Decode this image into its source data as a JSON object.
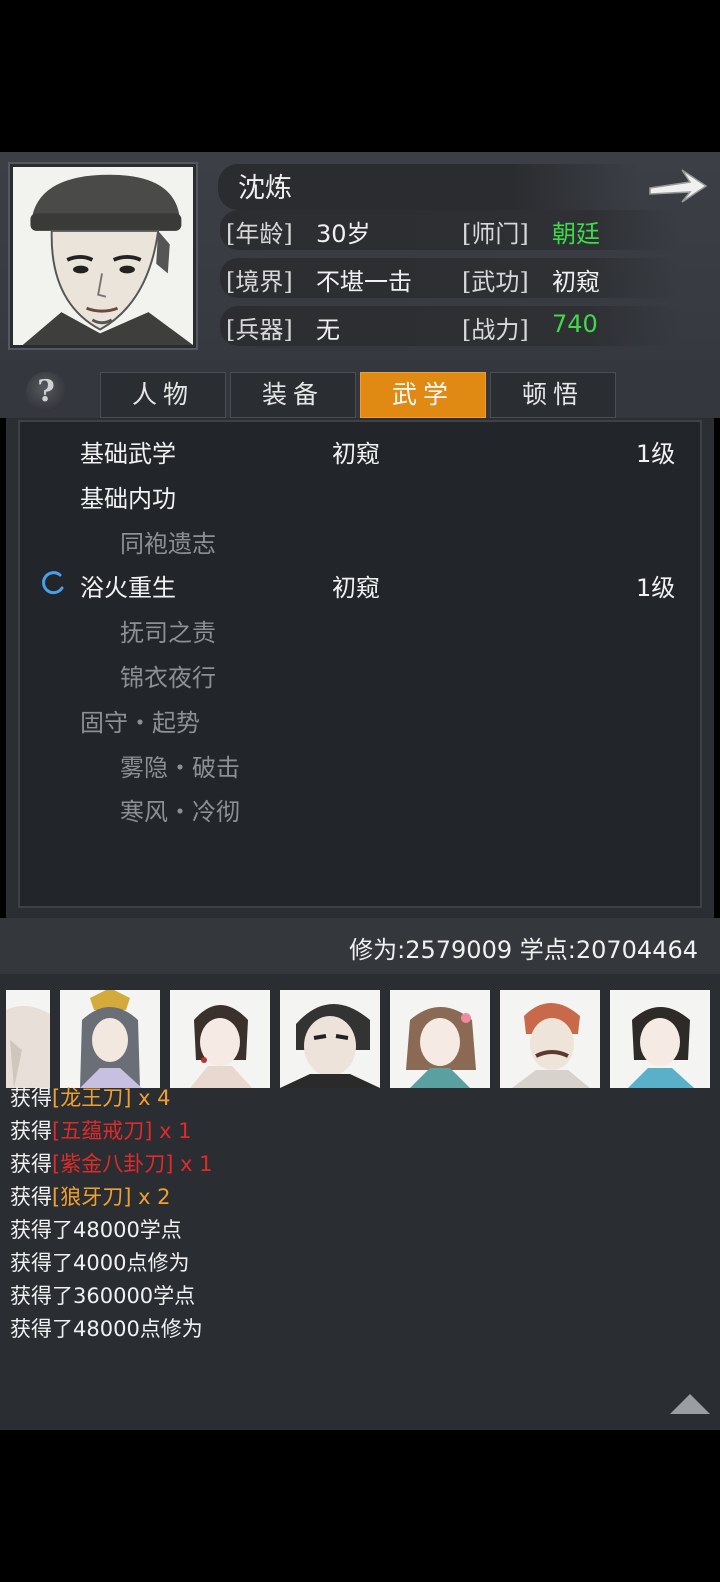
{
  "character": {
    "name": "沈炼",
    "age_label": "[年龄]",
    "age": "30岁",
    "sect_label": "[师门]",
    "sect": "朝廷",
    "realm_label": "[境界]",
    "realm": "不堪一击",
    "kungfu_label": "[武功]",
    "kungfu": "初窥",
    "weapon_label": "[兵器]",
    "weapon": "无",
    "power_label": "[战力]",
    "power": "740"
  },
  "tabs": [
    "人物",
    "装备",
    "武学",
    "顿悟"
  ],
  "active_tab": "武学",
  "help_label": "?",
  "skills": [
    {
      "name": "基础武学",
      "grade": "初窥",
      "level": "1级",
      "style": "main"
    },
    {
      "name": "基础内功",
      "grade": "",
      "level": "",
      "style": "main"
    },
    {
      "name": "同袍遗志",
      "grade": "",
      "level": "",
      "style": "dim"
    },
    {
      "name": "浴火重生",
      "grade": "初窥",
      "level": "1级",
      "style": "main"
    },
    {
      "name": "抚司之责",
      "grade": "",
      "level": "",
      "style": "dim"
    },
    {
      "name": "锦衣夜行",
      "grade": "",
      "level": "",
      "style": "dim"
    },
    {
      "name": "固守・起势",
      "grade": "",
      "level": "",
      "style": "dim"
    },
    {
      "name": "雾隐・破击",
      "grade": "",
      "level": "",
      "style": "dim"
    },
    {
      "name": "寒风・冷彻",
      "grade": "",
      "level": "",
      "style": "dim"
    }
  ],
  "stats": {
    "cultivation_label": "修为:",
    "cultivation": "2579009",
    "points_label": "学点:",
    "points": "20704464"
  },
  "log": [
    {
      "prefix": "获得",
      "item": "[龙王刀]",
      "suffix": " x 4",
      "color": "#f0a030"
    },
    {
      "prefix": "获得",
      "item": "[五蕴戒刀]",
      "suffix": " x 1",
      "color": "#e02a2a"
    },
    {
      "prefix": "获得",
      "item": "[紫金八卦刀]",
      "suffix": " x 1",
      "color": "#e02a2a"
    },
    {
      "prefix": "获得",
      "item": "[狼牙刀]",
      "suffix": " x 2",
      "color": "#f0a030"
    },
    {
      "prefix": "获得了48000学点",
      "item": "",
      "suffix": "",
      "color": ""
    },
    {
      "prefix": "获得了4000点修为",
      "item": "",
      "suffix": "",
      "color": ""
    },
    {
      "prefix": "获得了360000学点",
      "item": "",
      "suffix": "",
      "color": ""
    },
    {
      "prefix": "获得了48000点修为",
      "item": "",
      "suffix": "",
      "color": ""
    }
  ],
  "colors": {
    "accent": "#e08a14",
    "green": "#3fd94a",
    "orange": "#f0a030",
    "red": "#e02a2a"
  },
  "icons": [
    "arrow-right-icon",
    "help-icon",
    "loading-spinner-icon",
    "scroll-up-icon"
  ]
}
